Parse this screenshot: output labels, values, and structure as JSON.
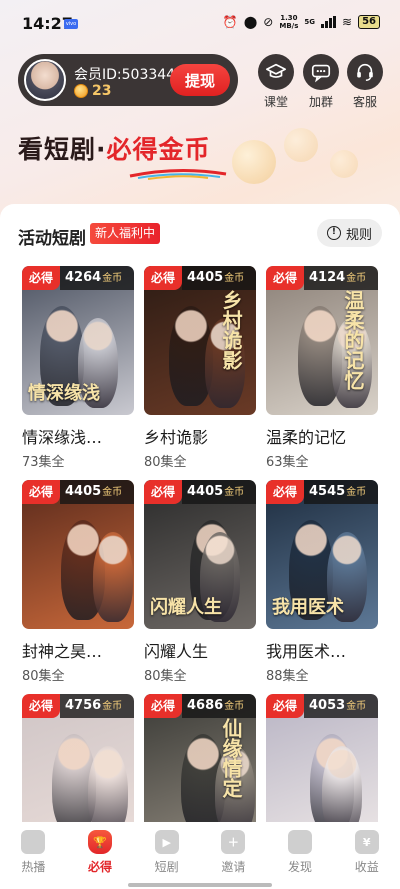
{
  "status_bar": {
    "time": "14:27",
    "net_speed_value": "1.30",
    "net_speed_unit": "MB/s",
    "network": "5G",
    "battery": "56"
  },
  "member": {
    "id_text": "会员ID:503344",
    "coins": "23",
    "withdraw_label": "提现"
  },
  "quick_links": [
    {
      "label": "课堂",
      "icon": "graduation-cap-icon"
    },
    {
      "label": "加群",
      "icon": "chat-group-icon"
    },
    {
      "label": "客服",
      "icon": "headset-icon"
    }
  ],
  "headline": {
    "part1": "看短剧·",
    "part2": "必得金币"
  },
  "section": {
    "title": "活动短剧",
    "tag": "新人福利中",
    "rules_label": "规则",
    "rules_icon": "info-icon"
  },
  "badge": {
    "label": "必得",
    "unit": "金币"
  },
  "dramas": [
    {
      "title": "情深缘浅…",
      "episodes": "73集全",
      "coins": "4264",
      "poster_text": "情深缘浅",
      "colors": [
        "#4a5160",
        "#c9c9d0"
      ]
    },
    {
      "title": "乡村诡影",
      "episodes": "80集全",
      "coins": "4405",
      "poster_text": "乡村诡影",
      "colors": [
        "#2b1b14",
        "#6a3a26"
      ]
    },
    {
      "title": "温柔的记忆",
      "episodes": "63集全",
      "coins": "4124",
      "poster_text": "温柔的记忆",
      "colors": [
        "#8a7f76",
        "#d9d2c9"
      ]
    },
    {
      "title": "封神之昊…",
      "episodes": "80集全",
      "coins": "4405",
      "poster_text": "",
      "colors": [
        "#5a2a1c",
        "#c8683a"
      ]
    },
    {
      "title": "闪耀人生",
      "episodes": "80集全",
      "coins": "4405",
      "poster_text": "闪耀人生",
      "colors": [
        "#2a2a2a",
        "#6f6a66"
      ]
    },
    {
      "title": "我用医术…",
      "episodes": "88集全",
      "coins": "4545",
      "poster_text": "我用医术",
      "colors": [
        "#1d2c3e",
        "#5d7896"
      ]
    },
    {
      "title": "",
      "episodes": "",
      "coins": "4756",
      "poster_text": "",
      "colors": [
        "#cfc5c6",
        "#e9dcd8"
      ]
    },
    {
      "title": "",
      "episodes": "",
      "coins": "4686",
      "poster_text": "仙缘情定",
      "colors": [
        "#3a3a36",
        "#8e877c"
      ]
    },
    {
      "title": "",
      "episodes": "",
      "coins": "4053",
      "poster_text": "",
      "colors": [
        "#b8b4c4",
        "#ece6e6"
      ]
    }
  ],
  "bottom_nav": [
    {
      "label": "热播",
      "icon": "flame-icon",
      "active": false
    },
    {
      "label": "必得",
      "icon": "trophy-icon",
      "active": true
    },
    {
      "label": "短剧",
      "icon": "tv-play-icon",
      "active": false
    },
    {
      "label": "邀请",
      "icon": "gift-plus-icon",
      "active": false
    },
    {
      "label": "发现",
      "icon": "compass-icon",
      "active": false
    },
    {
      "label": "收益",
      "icon": "money-bag-icon",
      "active": false
    }
  ],
  "colors": {
    "accent_red": "#e3262a",
    "pill_dark": "#3b3535",
    "coin_gold": "#f6c768"
  }
}
